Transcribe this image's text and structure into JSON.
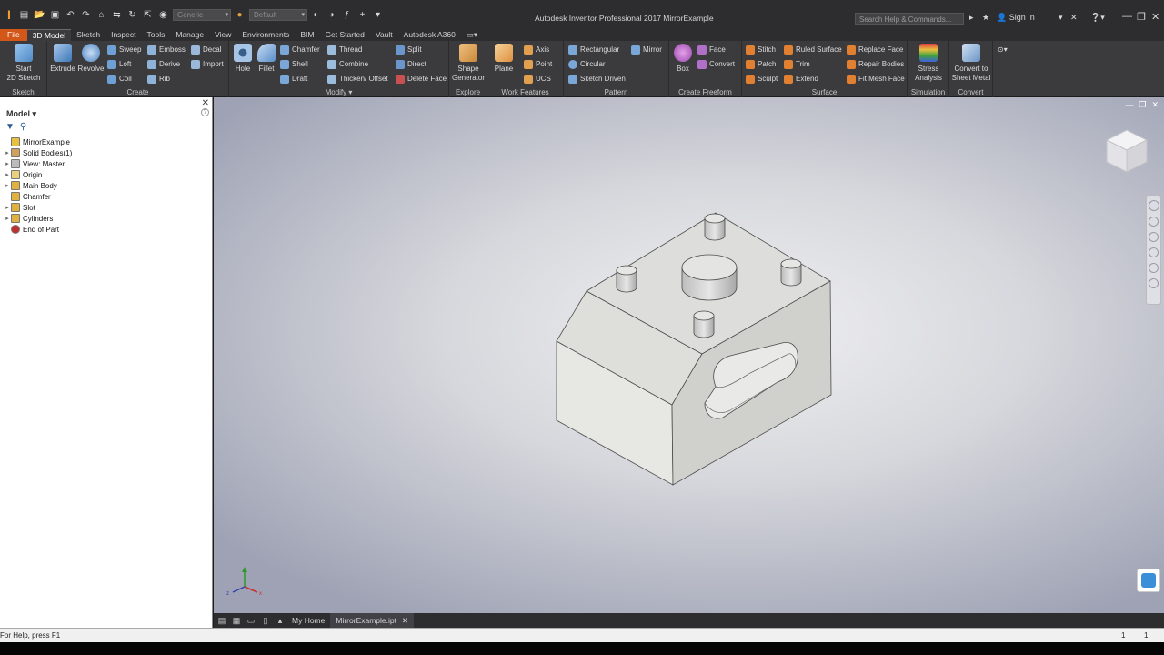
{
  "titlebar": {
    "title": "Autodesk Inventor Professional 2017    MirrorExample",
    "material_combo": "Generic",
    "appearance_combo": "Default",
    "search_placeholder": "Search Help & Commands...",
    "sign_in": "Sign In"
  },
  "tabs": [
    "File",
    "3D Model",
    "Sketch",
    "Inspect",
    "Tools",
    "Manage",
    "View",
    "Environments",
    "BIM",
    "Get Started",
    "Vault",
    "Autodesk A360"
  ],
  "ribbon": {
    "sketch": {
      "title": "Sketch",
      "start_sketch": "Start\n2D Sketch"
    },
    "create": {
      "title": "Create",
      "extrude": "Extrude",
      "revolve": "Revolve",
      "sweep": "Sweep",
      "loft": "Loft",
      "coil": "Coil",
      "emboss": "Emboss",
      "derive": "Derive",
      "rib": "Rib",
      "decal": "Decal",
      "import": "Import"
    },
    "modify": {
      "title": "Modify ▾",
      "hole": "Hole",
      "fillet": "Fillet",
      "chamfer": "Chamfer",
      "shell": "Shell",
      "draft": "Draft",
      "thread": "Thread",
      "combine": "Combine",
      "thicken": "Thicken/ Offset",
      "split": "Split",
      "direct": "Direct",
      "delete_face": "Delete Face"
    },
    "explore": {
      "title": "Explore",
      "shape_generator": "Shape\nGenerator"
    },
    "work_features": {
      "title": "Work Features",
      "plane": "Plane",
      "axis": "Axis",
      "point": "Point",
      "ucs": "UCS"
    },
    "pattern": {
      "title": "Pattern",
      "rectangular": "Rectangular",
      "circular": "Circular",
      "sketch_driven": "Sketch Driven",
      "mirror": "Mirror"
    },
    "freeform": {
      "title": "Create Freeform",
      "box": "Box",
      "face": "Face",
      "convert": "Convert"
    },
    "surface": {
      "title": "Surface",
      "stitch": "Stitch",
      "patch": "Patch",
      "sculpt": "Sculpt",
      "ruled_surface": "Ruled Surface",
      "trim": "Trim",
      "extend": "Extend",
      "replace_face": "Replace Face",
      "repair_bodies": "Repair Bodies",
      "fit_mesh_face": "Fit Mesh Face"
    },
    "simulation": {
      "title": "Simulation",
      "stress": "Stress\nAnalysis"
    },
    "convert": {
      "title": "Convert",
      "sheet_metal": "Convert to\nSheet Metal"
    }
  },
  "browser": {
    "header": "Model ▾",
    "items": [
      {
        "label": "MirrorExample",
        "expander": "",
        "icon": "part-icon",
        "color": "#e8c040"
      },
      {
        "label": "Solid Bodies(1)",
        "expander": "▸",
        "icon": "solid-bodies-icon",
        "color": "#d0a060"
      },
      {
        "label": "View: Master",
        "expander": "▸",
        "icon": "view-icon",
        "color": "#bbbbbb"
      },
      {
        "label": "Origin",
        "expander": "▸",
        "icon": "folder-icon",
        "color": "#e8d080"
      },
      {
        "label": "Main Body",
        "expander": "▸",
        "icon": "extrude-feature-icon",
        "color": "#e0b040"
      },
      {
        "label": "Chamfer",
        "expander": "",
        "icon": "chamfer-feature-icon",
        "color": "#e0b040"
      },
      {
        "label": "Slot",
        "expander": "▸",
        "icon": "extrude-feature-icon",
        "color": "#e0b040"
      },
      {
        "label": "Cylinders",
        "expander": "▸",
        "icon": "extrude-feature-icon",
        "color": "#e0b040"
      },
      {
        "label": "End of Part",
        "expander": "",
        "icon": "end-of-part-icon",
        "color": "#c03030"
      }
    ]
  },
  "doctabs": {
    "home": "My Home",
    "active": "MirrorExample.ipt"
  },
  "status": {
    "help": "For Help, press F1",
    "count_a": "1",
    "count_b": "1"
  }
}
